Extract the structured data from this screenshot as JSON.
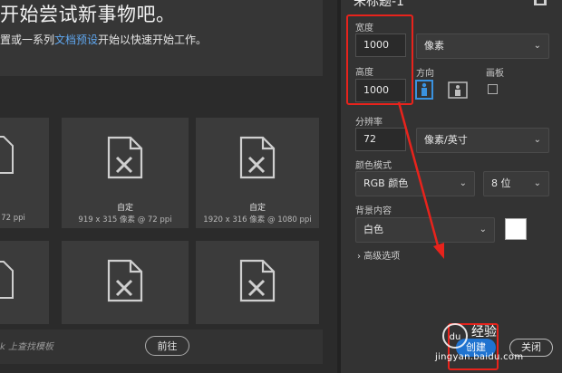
{
  "colors": {
    "accent": "#1f73d0",
    "annotation": "#e8231c",
    "link": "#5fa6ee"
  },
  "welcome": {
    "headline": "开始尝试新事物吧。",
    "sub_before": "置或一系列",
    "sub_link": "文档预设",
    "sub_after": "开始以快速开始工作。"
  },
  "presets": [
    {
      "title": "",
      "meta": "@ 72 ppi"
    },
    {
      "title": "自定",
      "meta": "919 x 315 像素 @ 72 ppi"
    },
    {
      "title": "自定",
      "meta": "1920 x 316 像素 @ 1080 ppi"
    },
    {
      "title": "",
      "meta": ""
    },
    {
      "title": "",
      "meta": ""
    },
    {
      "title": "",
      "meta": ""
    }
  ],
  "search": {
    "placeholder": "k 上查找模板",
    "go_label": "前往"
  },
  "details": {
    "doc_name": "未标题-1",
    "width_label": "宽度",
    "width_value": "1000",
    "width_unit": "像素",
    "height_label": "高度",
    "height_value": "1000",
    "orientation_label": "方向",
    "artboard_label": "画板",
    "resolution_label": "分辨率",
    "resolution_value": "72",
    "resolution_unit": "像素/英寸",
    "color_mode_label": "颜色模式",
    "color_mode_value": "RGB 颜色",
    "bit_depth_value": "8 位",
    "background_label": "背景内容",
    "background_value": "白色",
    "advanced_label": "高级选项",
    "create_label": "创建",
    "close_label": "关闭"
  },
  "watermark": {
    "text": "经验",
    "url": "jingyan.baidu.com"
  }
}
